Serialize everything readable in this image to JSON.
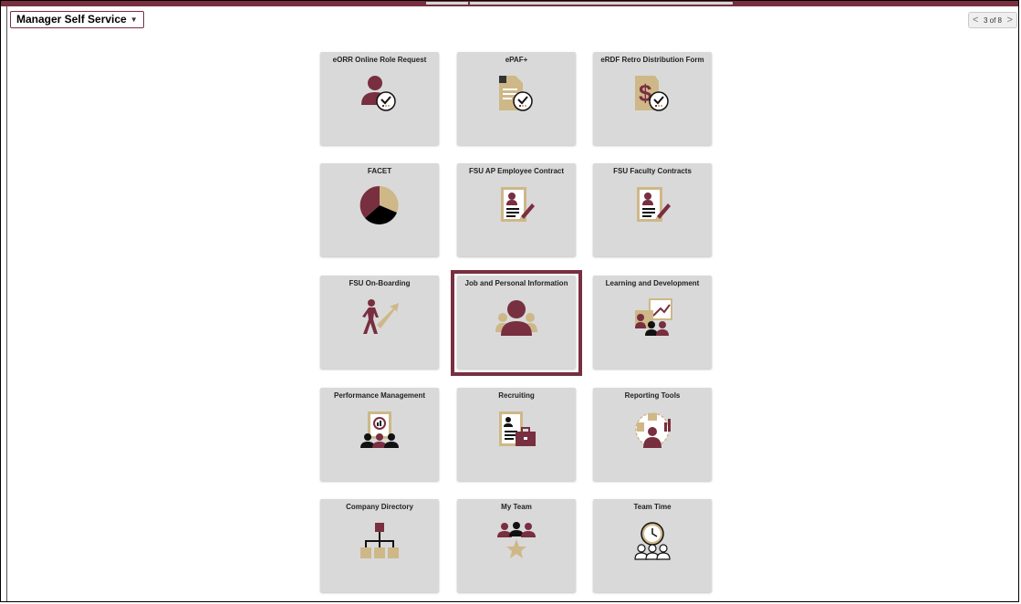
{
  "header": {
    "nav_title": "Manager Self Service",
    "pager": {
      "prev": "<",
      "text": "3 of 8",
      "next": ">"
    }
  },
  "tiles": [
    {
      "title": "eORR Online Role Request",
      "icon": "person-checkmark-icon"
    },
    {
      "title": "ePAF+",
      "icon": "document-checkmark-icon"
    },
    {
      "title": "eRDF Retro Distribution Form",
      "icon": "dollar-document-checkmark-icon"
    },
    {
      "title": "FACET",
      "icon": "pie-chart-icon"
    },
    {
      "title": "FSU AP Employee Contract",
      "icon": "contract-document-icon"
    },
    {
      "title": "FSU Faculty Contracts",
      "icon": "contract-document-icon"
    },
    {
      "title": "FSU On-Boarding",
      "icon": "walking-person-arrow-icon"
    },
    {
      "title": "Job and Personal Information",
      "icon": "person-group-icon"
    },
    {
      "title": "Learning and Development",
      "icon": "presentation-board-icon"
    },
    {
      "title": "Performance Management",
      "icon": "performance-review-icon"
    },
    {
      "title": "Recruiting",
      "icon": "resume-briefcase-icon"
    },
    {
      "title": "Reporting Tools",
      "icon": "person-reports-icon"
    },
    {
      "title": "Company Directory",
      "icon": "org-chart-icon"
    },
    {
      "title": "My Team",
      "icon": "team-star-icon"
    },
    {
      "title": "Team Time",
      "icon": "team-clock-icon"
    }
  ],
  "colors": {
    "garnet": "#782f40",
    "gold": "#ceb888",
    "tile": "#d9d9d9"
  },
  "highlighted_tile": "Job and Personal Information"
}
